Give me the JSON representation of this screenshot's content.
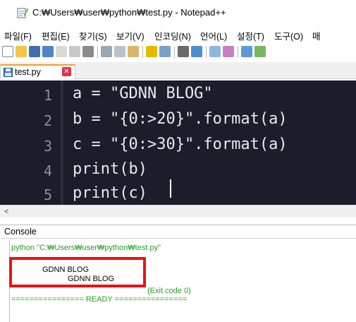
{
  "window": {
    "title": "C:₩Users₩user₩python₩test.py - Notepad++"
  },
  "menu": [
    "파일(F)",
    "편집(E)",
    "찾기(S)",
    "보기(V)",
    "인코딩(N)",
    "언어(L)",
    "설정(T)",
    "도구(O)",
    "매"
  ],
  "tabs": [
    {
      "label": "test.py",
      "close": "✕"
    }
  ],
  "editor": {
    "line_numbers": [
      "1",
      "2",
      "3",
      "4",
      "5"
    ],
    "lines": [
      "a = \"GDNN BLOG\"",
      "b = \"{0:>20}\".format(a)",
      "c = \"{0:>30}\".format(a)",
      "print(b)",
      "print(c)"
    ],
    "colors": {
      "background": "#1b1d2b",
      "text": "#e9e9ee",
      "line_number": "#8a8ea3"
    }
  },
  "scrollbar": {
    "left_arrow": "<"
  },
  "console": {
    "title": "Console",
    "command": "python \"C:₩Users₩user₩python₩test.py\"",
    "output": [
      "GDNN BLOG",
      "GDNN BLOG"
    ],
    "exit": "(Exit code 0)",
    "ready": "================ READY ================",
    "colors": {
      "log": "#20a020",
      "output": "#000000"
    }
  },
  "annotation": {
    "color": "#ee1111"
  }
}
